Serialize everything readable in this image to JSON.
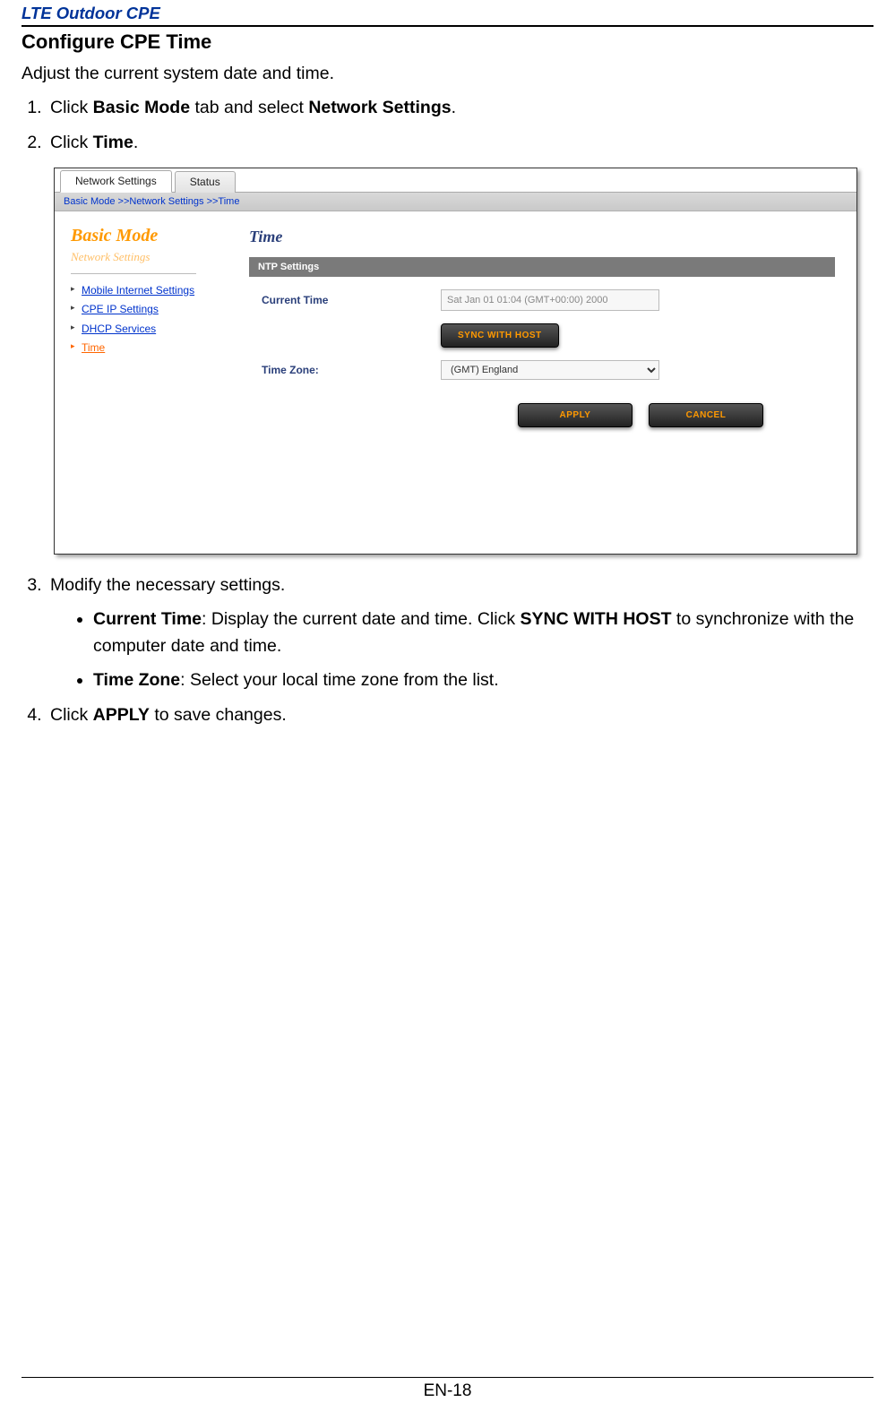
{
  "header": {
    "title": "LTE Outdoor CPE"
  },
  "section": {
    "heading": "Configure CPE Time",
    "intro": "Adjust the current system date and time."
  },
  "steps": {
    "s1_a": "Click ",
    "s1_b": "Basic Mode",
    "s1_c": " tab and select ",
    "s1_d": "Network Settings",
    "s1_e": ".",
    "s2_a": "Click ",
    "s2_b": "Time",
    "s2_c": ".",
    "s3": "Modify the necessary settings.",
    "b1_a": "Current Time",
    "b1_b": ": Display the current date and time. Click ",
    "b1_c": "SYNC WITH HOST",
    "b1_d": " to synchronize with the computer date and time.",
    "b2_a": "Time Zone",
    "b2_b": ": Select your local time zone from the list.",
    "s4_a": "Click ",
    "s4_b": "APPLY",
    "s4_c": " to save changes."
  },
  "shot": {
    "tabs": {
      "network": "Network Settings",
      "status": "Status"
    },
    "breadcrumb": "Basic Mode >>Network Settings >>Time",
    "sidebar": {
      "mode": "Basic Mode",
      "sub": "Network Settings",
      "items": [
        "Mobile Internet Settings",
        "CPE IP Settings",
        "DHCP Services",
        "Time"
      ]
    },
    "panel": {
      "title": "Time",
      "ntp_header": "NTP Settings",
      "current_time_label": "Current Time",
      "current_time_value": "Sat Jan 01 01:04 (GMT+00:00) 2000",
      "sync_btn": "SYNC WITH HOST",
      "tz_label": "Time Zone:",
      "tz_value": "(GMT) England",
      "apply_btn": "APPLY",
      "cancel_btn": "CANCEL"
    }
  },
  "footer": {
    "page": "EN-18"
  }
}
